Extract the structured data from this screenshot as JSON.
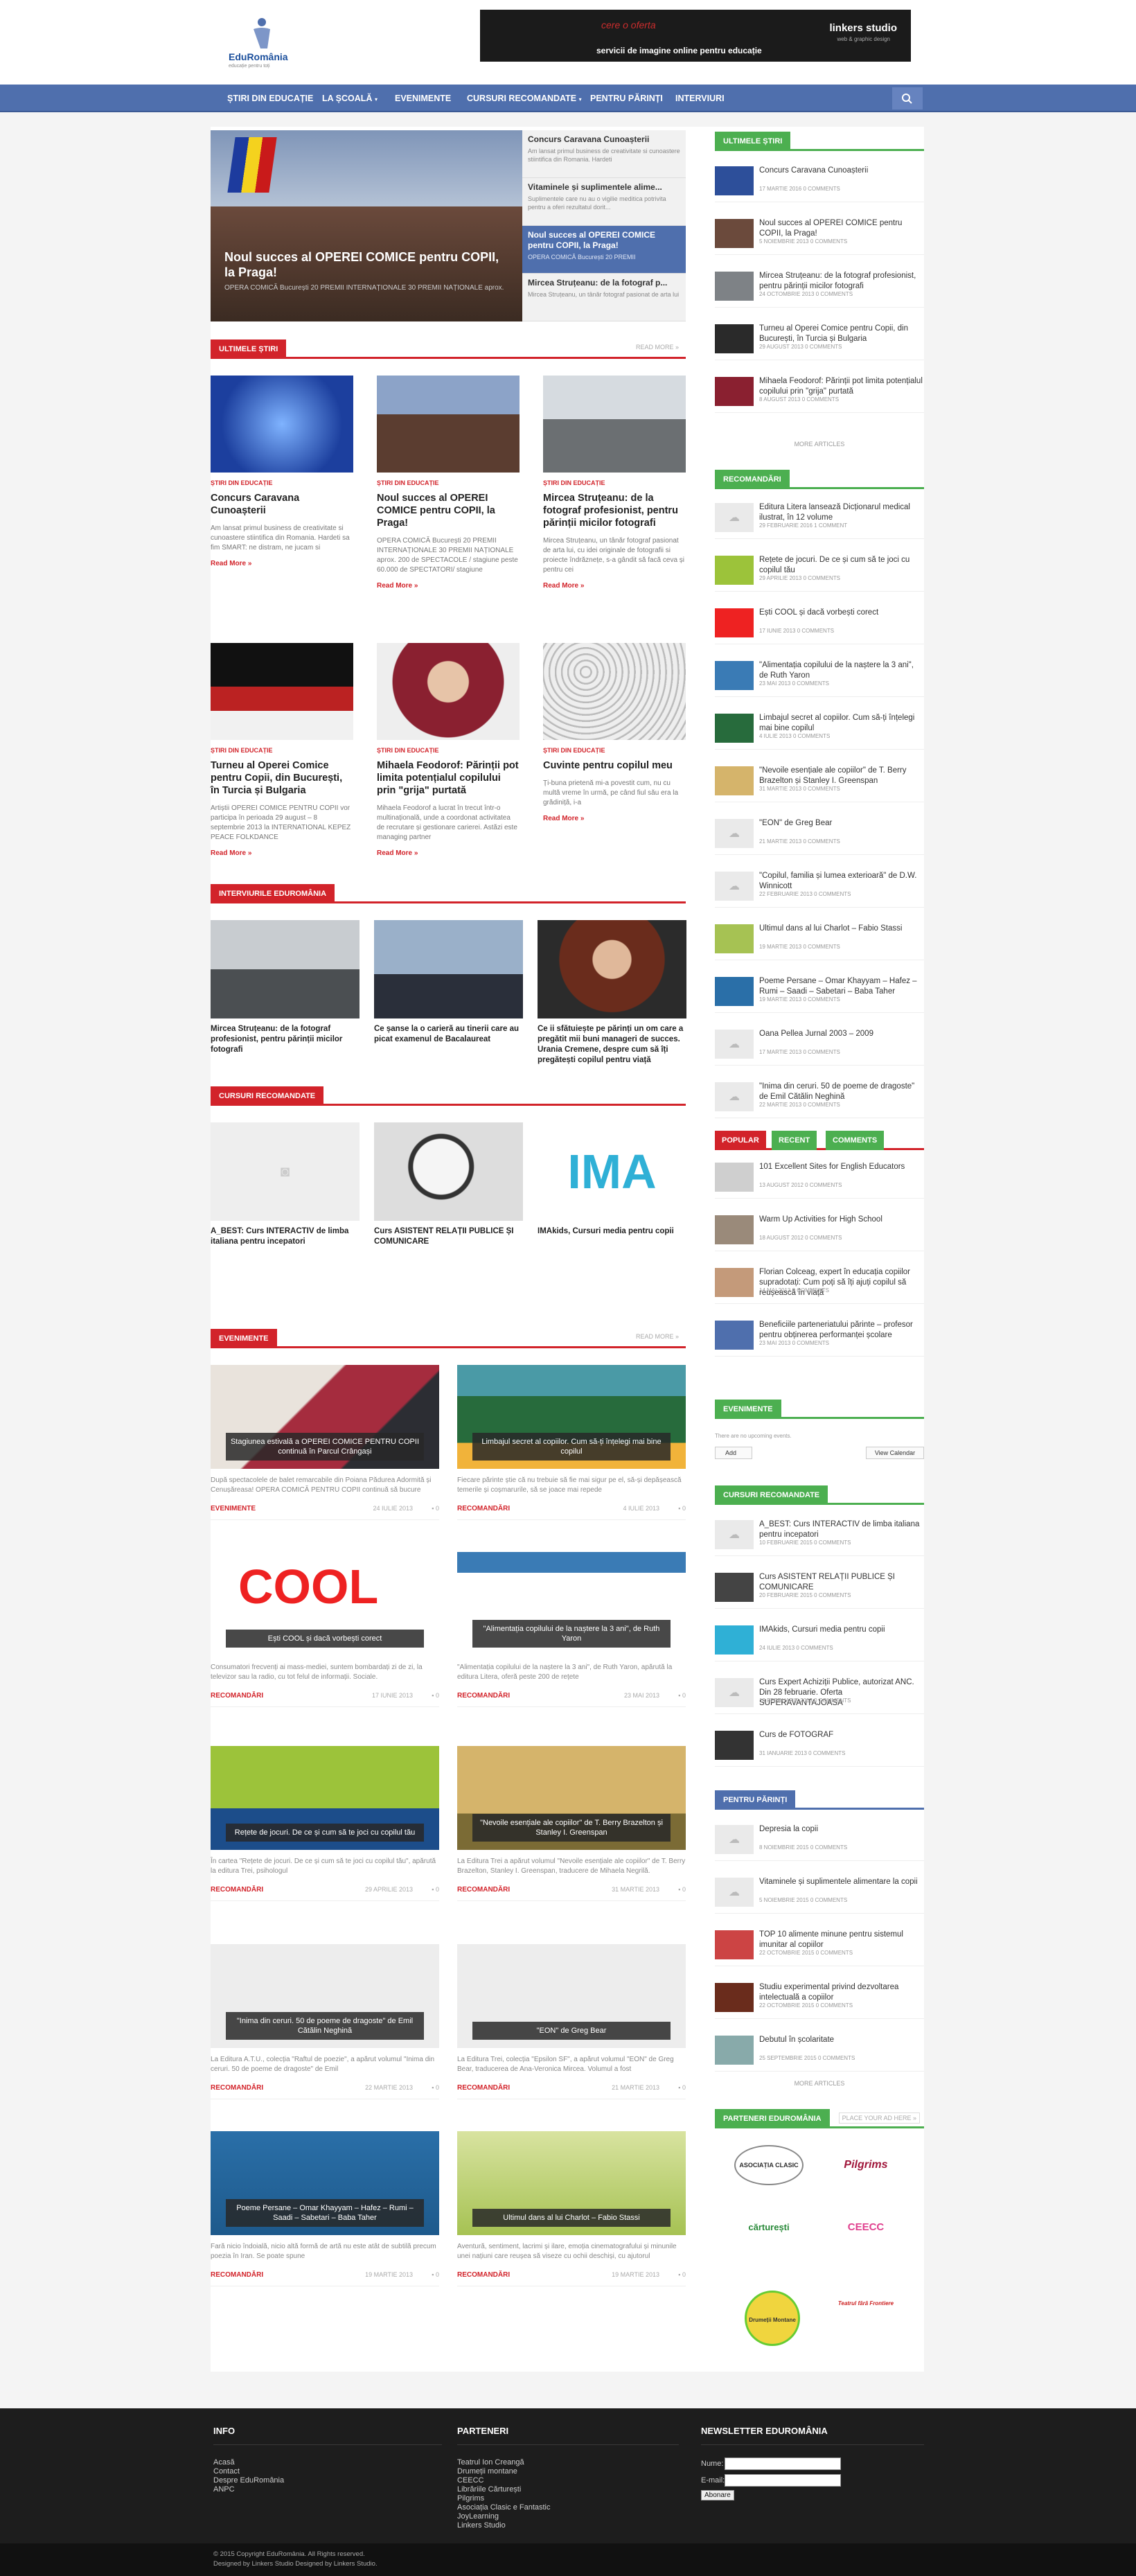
{
  "brand": {
    "name": "EduRomânia",
    "tagline": "educație pentru toți",
    "color_primary": "#4f6fad",
    "color_accent": "#d2232a",
    "color_green": "#4caf50"
  },
  "banner": {
    "line1": "cere o oferta",
    "line2": "servicii de imagine online pentru educație",
    "logo": "linkers studio",
    "logo_sub": "web & graphic design"
  },
  "nav": {
    "items": [
      "ȘTIRI DIN EDUCAȚIE",
      "LA ȘCOALĂ",
      "EVENIMENTE",
      "CURSURI RECOMANDATE",
      "PENTRU PĂRINȚI",
      "INTERVIURI"
    ],
    "search_icon": "search-icon"
  },
  "slider": {
    "title": "Noul succes al OPEREI COMICE pentru COPII, la Praga!",
    "excerpt": "OPERA COMICĂ București 20 PREMII INTERNAȚIONALE 30 PREMII NAȚIONALE aprox.",
    "side": [
      {
        "t": "Concurs Caravana Cunoașterii",
        "e": "Am lansat primul business de creativitate si cunoastere stiintifica din Romania. Hardeti"
      },
      {
        "t": "Vitaminele și suplimentele alime...",
        "e": "Suplimentele care nu au o vigilie meditica potrivita pentru a oferi rezultatul dorit..."
      },
      {
        "t": "Noul succes al OPEREI COMICE pentru COPII, la Praga!",
        "e": "OPERA COMICĂ București 20 PREMII"
      },
      {
        "t": "Mircea Struțeanu: de la fotograf p...",
        "e": "Mircea Struțeanu, un tânăr fotograf pasionat de arta lui"
      }
    ]
  },
  "latest": {
    "label": "ULTIMELE ȘTIRI",
    "more": "READ MORE »",
    "cards": [
      {
        "cat": "ȘTIRI DIN EDUCAȚIE",
        "t": "Concurs Caravana Cunoașterii",
        "e": "Am lansat primul business de creativitate si cunoastere stiintifica din Romania. Hardeti sa fim SMART: ne distram, ne jucam si",
        "rm": "Read More »"
      },
      {
        "cat": "ȘTIRI DIN EDUCAȚIE",
        "t": "Noul succes al OPEREI COMICE pentru COPII, la Praga!",
        "e": "OPERA COMICĂ București 20 PREMII INTERNAȚIONALE 30 PREMII NAȚIONALE aprox. 200 de SPECTACOLE / stagiune peste 60.000 de SPECTATORI/ stagiune",
        "rm": "Read More »"
      },
      {
        "cat": "ȘTIRI DIN EDUCAȚIE",
        "t": "Mircea Struțeanu: de la fotograf profesionist, pentru părinții micilor fotografi",
        "e": "Mircea Struțeanu, un tânăr fotograf pasionat de arta lui, cu idei originale de fotografii si proiecte îndrăznețe, s-a gândit să facă ceva și pentru cei",
        "rm": "Read More »"
      },
      {
        "cat": "ȘTIRI DIN EDUCAȚIE",
        "t": "Turneu al Operei Comice pentru Copii, din București, în Turcia și Bulgaria",
        "e": "Artiștii OPEREI COMICE PENTRU COPII vor participa în perioada 29 august – 8 septembrie 2013 la INTERNATIONAL KEPEZ PEACE FOLKDANCE",
        "rm": "Read More »"
      },
      {
        "cat": "ȘTIRI DIN EDUCAȚIE",
        "t": "Mihaela Feodorof: Părinții pot limita potențialul copilului prin \"grija\" purtată",
        "e": "Mihaela Feodorof a lucrat în trecut într-o multinațională, unde a coordonat activitatea de recrutare și gestionare carierei. Astăzi este managing partner",
        "rm": "Read More »"
      },
      {
        "cat": "ȘTIRI DIN EDUCAȚIE",
        "t": "Cuvinte pentru copilul meu",
        "e": "Ți-buna prietenă mi-a povestit cum, nu cu multă vreme în urmă, pe când fiul său era la grădiniță, i-a",
        "rm": "Read More »"
      }
    ]
  },
  "interviews": {
    "label": "INTERVIURILE EDUROMÂNIA",
    "cards": [
      {
        "t": "Mircea Struțeanu: de la fotograf profesionist, pentru părinții micilor fotografi"
      },
      {
        "t": "Ce șanse la o carieră au tinerii care au picat examenul de Bacalaureat"
      },
      {
        "t": "Ce ii sfătuiește pe părinți un om care a pregătit mii buni manageri de succes. Urania Cremene, despre cum să îți pregătești copilul pentru viață"
      }
    ]
  },
  "courses": {
    "label": "CURSURI RECOMANDATE",
    "cards": [
      {
        "t": "A_BEST: Curs INTERACTIV de limba italiana pentru incepatori"
      },
      {
        "t": "Curs ASISTENT RELAȚII PUBLICE ȘI COMUNICARE"
      },
      {
        "t": "IMAkids, Cursuri media pentru copii"
      }
    ],
    "ima_text": "IMA"
  },
  "events": {
    "label": "EVENIMENTE",
    "more": "READ MORE »",
    "cards": [
      {
        "cap": "Stagiunea estivală a OPEREI COMICE PENTRU COPII continuă în Parcul Crângași",
        "e": "După spectacolele de balet remarcabile din Poiana Pădurea Adormită și Cenușăreasa! OPERA COMICĂ PENTRU COPII continuă să bucure publicului",
        "cat": "EVENIMENTE",
        "date": "24 IULIE 2013",
        "cm": "0"
      },
      {
        "cap": "Limbajul secret al copiilor. Cum să-ți înțelegi mai bine copilul",
        "e": "Fiecare părinte știe că nu trebuie să fie mai sigur pe el, să-și depășească temerile și coșmarurile, să se joace mai repede",
        "cat": "RECOMANDĂRI",
        "date": "4 IULIE 2013",
        "cm": "0"
      },
      {
        "cap": "Ești COOL și dacă vorbești corect",
        "e": "Consumatori frecvenți ai mass-mediei, suntem bombardați zi de zi, la televizor sau la radio, cu tot felul de informații. Sociale.",
        "cat": "RECOMANDĂRI",
        "date": "17 IUNIE 2013",
        "cm": "0"
      },
      {
        "cap": "\"Alimentația copilului de la naștere la 3 ani\", de Ruth Yaron",
        "e": "\"Alimentația copilului de la naștere la 3 ani\", de Ruth Yaron, apărută la editura Litera, oferă peste 200 de rețete",
        "cat": "RECOMANDĂRI",
        "date": "23 MAI 2013",
        "cm": "0"
      },
      {
        "cap": "Rețete de jocuri. De ce și cum să te joci cu copilul tău",
        "e": "În cartea \"Rețete de jocuri. De ce și cum să te joci cu copilul tău\", apărută la editura Trei, psihologul",
        "cat": "RECOMANDĂRI",
        "date": "29 APRILIE 2013",
        "cm": "0"
      },
      {
        "cap": "\"Nevoile esențiale ale copiilor\" de T. Berry Brazelton și Stanley I. Greenspan",
        "e": "La Editura Trei a apărut volumul \"Nevoile esențiale ale copiilor\" de T. Berry Brazelton, Stanley I. Greenspan, traducere de Mihaela Negrilă.",
        "cat": "RECOMANDĂRI",
        "date": "31 MARTIE 2013",
        "cm": "0"
      },
      {
        "cap": "\"Inima din ceruri. 50 de poeme de dragoste\" de Emil Cătălin Neghină",
        "e": "La Editura A.T.U., colecția \"Raftul de poezie\", a apărut volumul \"Inima din ceruri. 50 de poeme de dragoste\" de Emil",
        "cat": "RECOMANDĂRI",
        "date": "22 MARTIE 2013",
        "cm": "0"
      },
      {
        "cap": "\"EON\" de Greg Bear",
        "e": "La Editura Trei, colecția \"Epsilon SF\", a apărut volumul \"EON\" de Greg Bear, traducerea de Ana-Veronica Mircea. Volumul a fost",
        "cat": "RECOMANDĂRI",
        "date": "21 MARTIE 2013",
        "cm": "0"
      },
      {
        "cap": "Poeme Persane – Omar Khayyam – Hafez – Rumi – Saadi – Sabetari – Baba Taher",
        "e": "Fară nicio îndoială, nicio altă formă de artă nu este atât de subtilă precum poezia în Iran. Se poate spune",
        "cat": "RECOMANDĂRI",
        "date": "19 MARTIE 2013",
        "cm": "0"
      },
      {
        "cap": "Ultimul dans al lui Charlot – Fabio Stassi",
        "e": "Aventură, sentiment, lacrimi și ilare, emoția cinematografului și minunile unei națiuni care reușea să viseze cu ochii deschiși, cu ajutorul",
        "cat": "RECOMANDĂRI",
        "date": "19 MARTIE 2013",
        "cm": "0"
      }
    ]
  },
  "sidebar": {
    "latest": {
      "label": "ULTIMELE ȘTIRI",
      "items": [
        {
          "t": "Concurs Caravana Cunoașterii",
          "d": "17 MARTIE 2016",
          "c": "0 COMMENTS"
        },
        {
          "t": "Noul succes al OPEREI COMICE pentru COPII, la Praga!",
          "d": "5 NOIEMBRIE 2013",
          "c": "0 COMMENTS"
        },
        {
          "t": "Mircea Struțeanu: de la fotograf profesionist, pentru părinții micilor fotografi",
          "d": "24 OCTOMBRIE 2013",
          "c": "0 COMMENTS"
        },
        {
          "t": "Turneu al Operei Comice pentru Copii, din București, în Turcia și Bulgaria",
          "d": "29 AUGUST 2013",
          "c": "0 COMMENTS"
        },
        {
          "t": "Mihaela Feodorof: Părinții pot limita potențialul copilului prin \"grija\" purtată",
          "d": "8 AUGUST 2013",
          "c": "0 COMMENTS"
        }
      ],
      "more": "MORE ARTICLES"
    },
    "recommend": {
      "label": "RECOMANDĂRI",
      "items": [
        {
          "t": "Editura Litera lansează Dicționarul medical ilustrat, în 12 volume",
          "d": "29 FEBRUARIE 2016",
          "c": "1 COMMENT"
        },
        {
          "t": "Rețete de jocuri. De ce și cum să te joci cu copilul tău",
          "d": "29 APRILIE 2013",
          "c": "0 COMMENTS"
        },
        {
          "t": "Ești COOL și dacă vorbești corect",
          "d": "17 IUNIE 2013",
          "c": "0 COMMENTS"
        },
        {
          "t": "\"Alimentația copilului de la naștere la 3 ani\", de Ruth Yaron",
          "d": "23 MAI 2013",
          "c": "0 COMMENTS"
        },
        {
          "t": "Limbajul secret al copiilor. Cum să-ți înțelegi mai bine copilul",
          "d": "4 IULIE 2013",
          "c": "0 COMMENTS"
        },
        {
          "t": "\"Nevoile esențiale ale copiilor\" de T. Berry Brazelton și Stanley I. Greenspan",
          "d": "31 MARTIE 2013",
          "c": "0 COMMENTS"
        },
        {
          "t": "\"EON\" de Greg Bear",
          "d": "21 MARTIE 2013",
          "c": "0 COMMENTS"
        },
        {
          "t": "\"Copilul, familia și lumea exterioară\" de D.W. Winnicott",
          "d": "22 FEBRUARIE 2013",
          "c": "0 COMMENTS"
        },
        {
          "t": "Ultimul dans al lui Charlot – Fabio Stassi",
          "d": "19 MARTIE 2013",
          "c": "0 COMMENTS"
        },
        {
          "t": "Poeme Persane – Omar Khayyam – Hafez – Rumi – Saadi – Sabetari – Baba Taher",
          "d": "19 MARTIE 2013",
          "c": "0 COMMENTS"
        },
        {
          "t": "Oana Pellea Jurnal 2003 – 2009",
          "d": "17 MARTIE 2013",
          "c": "0 COMMENTS"
        },
        {
          "t": "\"Inima din ceruri. 50 de poeme de dragoste\" de Emil Cătălin Neghină",
          "d": "22 MARTIE 2013",
          "c": "0 COMMENTS"
        }
      ]
    },
    "tabs": {
      "popular": "POPULAR",
      "recent": "RECENT",
      "comments": "COMMENTS",
      "items": [
        {
          "t": "101 Excellent Sites for English Educators",
          "d": "13 AUGUST 2012",
          "c": "0 COMMENTS"
        },
        {
          "t": "Warm Up Activities for High School",
          "d": "18 AUGUST 2012",
          "c": "0 COMMENTS"
        },
        {
          "t": "Florian Colceag, expert în educația copiilor supradotați: Cum poți să îți ajuți copilul să reușească în viață",
          "d": "14 MAI 2013",
          "c": "0 COMMENTS"
        },
        {
          "t": "Beneficiile parteneriatului părinte – profesor pentru obținerea performanței școlare",
          "d": "23 MAI 2013",
          "c": "0 COMMENTS"
        }
      ]
    },
    "events": {
      "label": "EVENIMENTE",
      "none": "There are no upcoming events.",
      "add": "Add",
      "view": "View Calendar"
    },
    "courses": {
      "label": "CURSURI RECOMANDATE",
      "items": [
        {
          "t": "A_BEST: Curs INTERACTIV de limba italiana pentru incepatori",
          "d": "10 FEBRUARIE 2015",
          "c": "0 COMMENTS"
        },
        {
          "t": "Curs ASISTENT RELAȚII PUBLICE ȘI COMUNICARE",
          "d": "20 FEBRUARIE 2015",
          "c": "0 COMMENTS"
        },
        {
          "t": "IMAkids, Cursuri media pentru copii",
          "d": "24 IULIE 2013",
          "c": "0 COMMENTS"
        },
        {
          "t": "Curs Expert Achiziții Publice, autorizat ANC. Din 28 februarie. Oferta SUPERAVANTAJOASA",
          "d": "19 FEBRUARIE 2013",
          "c": "0 COMMENTS"
        },
        {
          "t": "Curs de FOTOGRAF",
          "d": "31 IANUARIE 2013",
          "c": "0 COMMENTS"
        }
      ]
    },
    "parents": {
      "label": "PENTRU PĂRINȚI",
      "items": [
        {
          "t": "Depresia la copii",
          "d": "8 NOIEMBRIE 2015",
          "c": "0 COMMENTS"
        },
        {
          "t": "Vitaminele și suplimentele alimentare la copii",
          "d": "5 NOIEMBRIE 2015",
          "c": "0 COMMENTS"
        },
        {
          "t": "TOP 10 alimente minune pentru sistemul imunitar al copiilor",
          "d": "22 OCTOMBRIE 2015",
          "c": "0 COMMENTS"
        },
        {
          "t": "Studiu experimental privind dezvoltarea intelectuală a copiilor",
          "d": "22 OCTOMBRIE 2015",
          "c": "0 COMMENTS"
        },
        {
          "t": "Debutul în școlaritate",
          "d": "25 SEPTEMBRIE 2015",
          "c": "0 COMMENTS"
        }
      ],
      "more": "MORE ARTICLES"
    },
    "partners": {
      "label": "PARTENERI EDUROMÂNIA",
      "cta": "PLACE YOUR AD HERE »",
      "logos": [
        "ASOCIAȚIA CLASIC",
        "Pilgrims",
        "cărturești",
        "CEECC",
        "Drumeții Montane",
        "Teatrul fără Frontiere"
      ]
    }
  },
  "footer": {
    "info": {
      "h": "INFO",
      "links": [
        "Acasă",
        "Contact",
        "Despre EduRomânia",
        "ANPC"
      ]
    },
    "partners": {
      "h": "PARTENERI",
      "links": [
        "Teatrul Ion Creangă",
        "Drumeții montane",
        "CEECC",
        "Librăriile Cărturești",
        "Pilgrims",
        "Asociația Clasic e Fantastic",
        "JoyLearning",
        "Linkers Studio"
      ]
    },
    "newsletter": {
      "h": "NEWSLETTER EDUROMÂNIA",
      "name": "Nume:",
      "email": "E-mail:",
      "btn": "Abonare"
    },
    "copy1": "© 2015 Copyright EduRomânia. All Rights reserved.",
    "copy2": "Designed by Linkers Studio Designed by Linkers Studio."
  }
}
